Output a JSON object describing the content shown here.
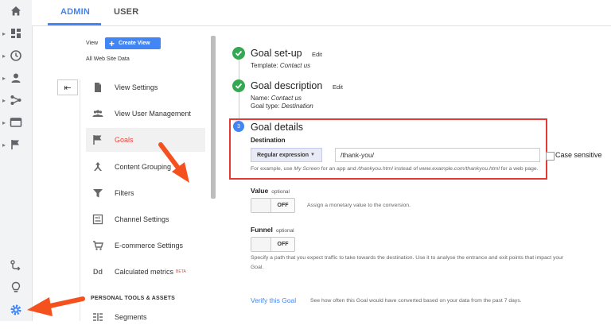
{
  "tabs": {
    "admin": "ADMIN",
    "user": "USER"
  },
  "view": {
    "label": "View",
    "create_button": "Create View",
    "name": "All Web Site Data",
    "back_glyph": "⇤"
  },
  "menu": {
    "items": [
      {
        "label": "View Settings",
        "icon": "document-icon"
      },
      {
        "label": "View User Management",
        "icon": "users-icon"
      },
      {
        "label": "Goals",
        "icon": "flag-icon"
      },
      {
        "label": "Content Grouping",
        "icon": "grouping-icon"
      },
      {
        "label": "Filters",
        "icon": "filter-icon"
      },
      {
        "label": "Channel Settings",
        "icon": "channel-icon"
      },
      {
        "label": "E-commerce Settings",
        "icon": "cart-icon"
      },
      {
        "label": "Calculated metrics",
        "icon": "dd-icon",
        "icon_text": "Dd",
        "badge": "BETA"
      },
      {
        "label": "Segments",
        "icon": "segments-icon"
      }
    ],
    "section_heading": "PERSONAL TOOLS & ASSETS"
  },
  "goal": {
    "setup": {
      "title": "Goal set-up",
      "edit": "Edit",
      "template_label": "Template:",
      "template_value": "Contact us"
    },
    "description": {
      "title": "Goal description",
      "edit": "Edit",
      "name_label": "Name:",
      "name_value": "Contact us",
      "type_label": "Goal type:",
      "type_value": "Destination"
    },
    "details": {
      "number": "3",
      "title": "Goal details",
      "destination_label": "Destination",
      "match_type": "Regular expression",
      "destination_value": "/thank-you/",
      "case_sensitive": "Case sensitive",
      "help": {
        "p1": "For example, use ",
        "e1": "My Screen",
        "p2": " for an app and ",
        "e2": "/thankyou.html",
        "p3": " instead of ",
        "e3": "www.example.com/thankyou.html",
        "p4": " for a web page."
      }
    },
    "value": {
      "label": "Value",
      "optional": "optional",
      "toggle": "OFF",
      "help": "Assign a monetary value to the conversion."
    },
    "funnel": {
      "label": "Funnel",
      "optional": "optional",
      "toggle": "OFF",
      "help_line1": "Specify a path that you expect traffic to take towards the destination. Use it to analyse the entrance and exit points that impact your",
      "help_line2": "Goal."
    },
    "verify": {
      "link": "Verify this Goal",
      "help": "See how often this Goal would have converted based on your data from the past 7 days."
    }
  },
  "colors": {
    "accent": "#4285f4",
    "success": "#34a853",
    "highlight": "#e53935",
    "arrow": "#f4511e"
  }
}
